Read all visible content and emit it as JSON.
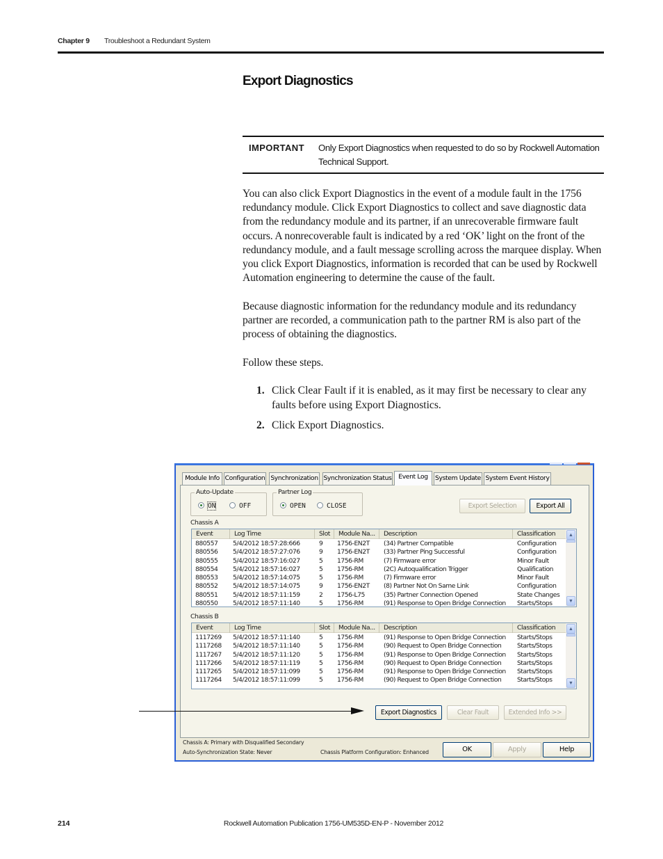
{
  "header": {
    "chapter": "Chapter 9",
    "chapter_title": "Troubleshoot a Redundant System"
  },
  "section": {
    "title": "Export Diagnostics"
  },
  "important": {
    "label": "IMPORTANT",
    "text": "Only Export Diagnostics when requested to do so by Rockwell Automation Technical Support."
  },
  "body": {
    "p1": "You can also click Export Diagnostics in the event of a module fault in the 1756 redundancy module. Click Export Diagnostics to collect and save diagnostic data from the redundancy module and its partner, if an unrecoverable firmware fault occurs. A nonrecoverable fault is indicated by a red ‘OK’ light on the front of the redundancy module, and a fault message scrolling across the marquee display. When you click Export Diagnostics, information is recorded that can be used by Rockwell Automation engineering to determine the cause of the fault.",
    "p2": "Because diagnostic information for the redundancy module and its redundancy partner are recorded, a communication path to the partner RM is also part of the process of obtaining the diagnostics.",
    "p3": "Follow these steps.",
    "steps": [
      {
        "num": "1.",
        "text": "Click Clear Fault if it is enabled, as it may first be necessary to clear any faults before using Export Diagnostics."
      },
      {
        "num": "2.",
        "text": "Click Export Diagnostics."
      }
    ]
  },
  "dialog": {
    "tabs": [
      {
        "label": "Module Info"
      },
      {
        "label": "Configuration"
      },
      {
        "label": "Synchronization"
      },
      {
        "label": "Synchronization Status"
      },
      {
        "label": "Event Log",
        "active": true
      },
      {
        "label": "System Update"
      },
      {
        "label": "System Event History"
      }
    ],
    "auto_update": {
      "legend": "Auto-Update",
      "options": [
        "ON",
        "OFF"
      ],
      "selected": "ON"
    },
    "partner_log": {
      "legend": "Partner Log",
      "options": [
        "OPEN",
        "CLOSE"
      ],
      "selected": "OPEN"
    },
    "buttons": {
      "export_selection": "Export Selection",
      "export_all": "Export All",
      "export_diagnostics": "Export Diagnostics",
      "clear_fault": "Clear Fault",
      "extended_info": "Extended Info >>",
      "ok": "OK",
      "apply": "Apply",
      "help": "Help"
    },
    "columns": [
      "Event",
      "Log Time",
      "Slot",
      "Module Na...",
      "Description",
      "Classification"
    ],
    "chassis_a": {
      "label": "Chassis A",
      "rows": [
        [
          "880557",
          "5/4/2012 18:57:28:666",
          "9",
          "1756-EN2T",
          "(34) Partner Compatible",
          "Configuration"
        ],
        [
          "880556",
          "5/4/2012 18:57:27:076",
          "9",
          "1756-EN2T",
          "(33) Partner Ping Successful",
          "Configuration"
        ],
        [
          "880555",
          "5/4/2012 18:57:16:027",
          "5",
          "1756-RM",
          "(7) Firmware error",
          "Minor Fault"
        ],
        [
          "880554",
          "5/4/2012 18:57:16:027",
          "5",
          "1756-RM",
          "(2C) Autoqualification Trigger",
          "Qualification"
        ],
        [
          "880553",
          "5/4/2012 18:57:14:075",
          "5",
          "1756-RM",
          "(7) Firmware error",
          "Minor Fault"
        ],
        [
          "880552",
          "5/4/2012 18:57:14:075",
          "9",
          "1756-EN2T",
          "(8) Partner Not On Same Link",
          "Configuration"
        ],
        [
          "880551",
          "5/4/2012 18:57:11:159",
          "2",
          "1756-L75",
          "(35) Partner Connection Opened",
          "State Changes"
        ],
        [
          "880550",
          "5/4/2012 18:57:11:140",
          "5",
          "1756-RM",
          "(91) Response to Open Bridge Connection",
          "Starts/Stops"
        ]
      ]
    },
    "chassis_b": {
      "label": "Chassis B",
      "rows": [
        [
          "1117269",
          "5/4/2012 18:57:11:140",
          "5",
          "1756-RM",
          "(91) Response to Open Bridge Connection",
          "Starts/Stops"
        ],
        [
          "1117268",
          "5/4/2012 18:57:11:140",
          "5",
          "1756-RM",
          "(90) Request to Open Bridge Connection",
          "Starts/Stops"
        ],
        [
          "1117267",
          "5/4/2012 18:57:11:120",
          "5",
          "1756-RM",
          "(91) Response to Open Bridge Connection",
          "Starts/Stops"
        ],
        [
          "1117266",
          "5/4/2012 18:57:11:119",
          "5",
          "1756-RM",
          "(90) Request to Open Bridge Connection",
          "Starts/Stops"
        ],
        [
          "1117265",
          "5/4/2012 18:57:11:099",
          "5",
          "1756-RM",
          "(91) Response to Open Bridge Connection",
          "Starts/Stops"
        ],
        [
          "1117264",
          "5/4/2012 18:57:11:099",
          "5",
          "1756-RM",
          "(90) Request to Open Bridge Connection",
          "Starts/Stops"
        ]
      ]
    },
    "status": {
      "chassis_state": "Chassis A: Primary with Disqualified Secondary",
      "auto_sync": "Auto-Synchronization State:  Never",
      "platform": "Chassis Platform Configuration:  Enhanced"
    }
  },
  "footer": {
    "page": "214",
    "publication": "Rockwell Automation Publication 1756-UM535D-EN-P - November 2012"
  }
}
